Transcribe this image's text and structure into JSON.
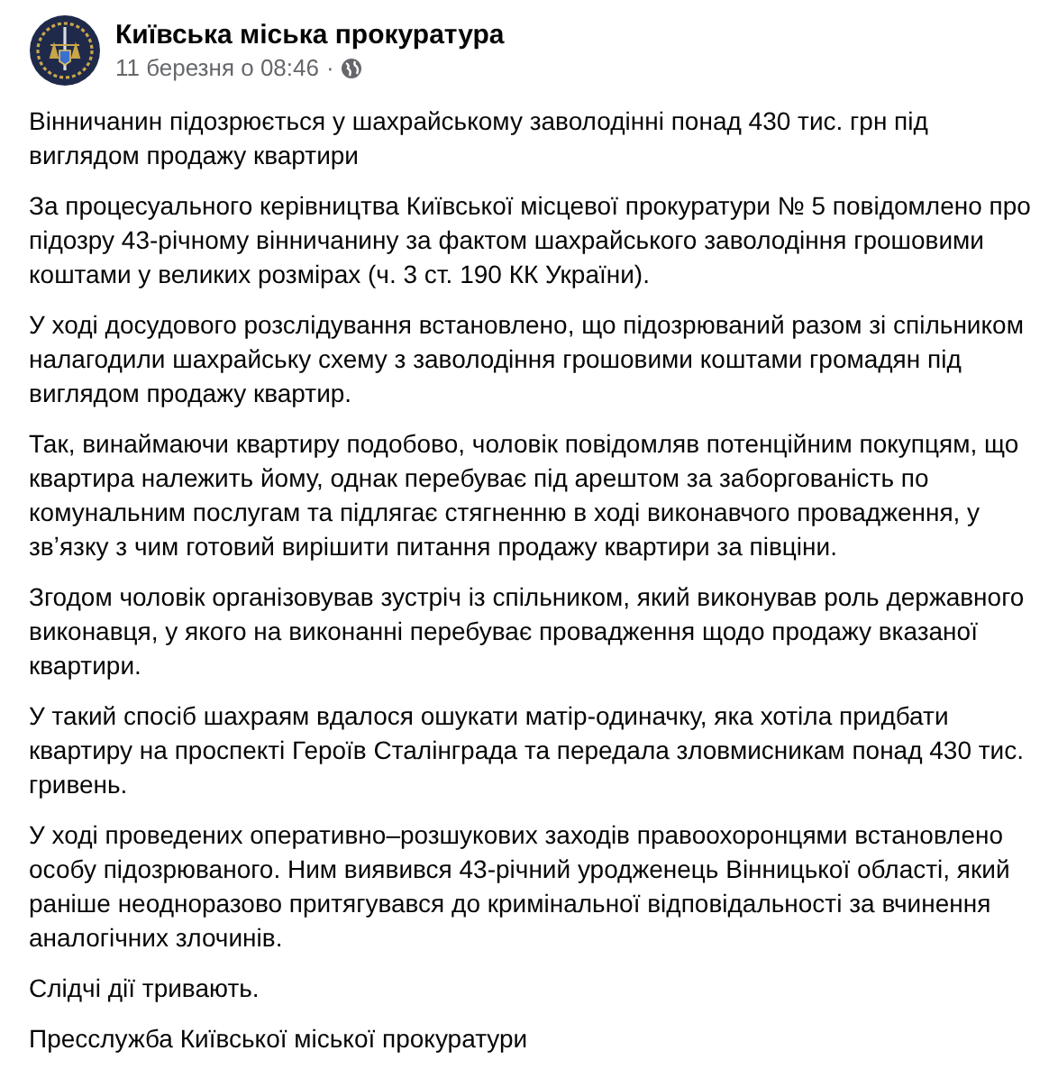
{
  "post": {
    "author": "Київська міська прокуратура",
    "timestamp": "11 березня о 08:46",
    "separator": "·",
    "paragraphs": [
      "Вінничанин підозрюється у шахрайському заволодінні понад 430 тис. грн під виглядом продажу квартири",
      "За процесуального керівництва Київської місцевої прокуратури № 5 повідомлено про підозру 43-річному вінничанину за фактом шахрайського заволодіння грошовими коштами у великих розмірах (ч. 3 ст. 190 КК України).",
      "У ході досудового розслідування встановлено, що підозрюваний разом зі спільником налагодили шахрайську схему з заволодіння грошовими коштами громадян під виглядом продажу квартир.",
      "Так, винаймаючи квартиру подобово, чоловік повідомляв потенційним покупцям, що квартира належить йому, однак перебуває під арештом за заборгованість по комунальним послугам та підлягає стягненню в ході виконавчого провадження, у звʼязку з чим готовий вирішити питання продажу квартири за півціни.",
      "Згодом чоловік організовував зустріч із спільником, який виконував роль державного виконавця, у якого на виконанні перебуває провадження щодо продажу вказаної квартири.",
      "У такий спосіб шахраям вдалося ошукати матір-одиначку, яка хотіла придбати квартиру на проспекті Героїв Сталінграда та передала зловмисникам понад 430 тис. гривень.",
      "У ході проведених оперативно–розшукових заходів правоохоронцями встановлено особу підозрюваного. Ним виявився 43-річний уродженець Вінницької області, який раніше неодноразово притягувався до кримінальної відповідальності за вчинення аналогічних злочинів.",
      "Слідчі дії тривають.",
      "Пресслужба Київської міської прокуратури"
    ]
  }
}
